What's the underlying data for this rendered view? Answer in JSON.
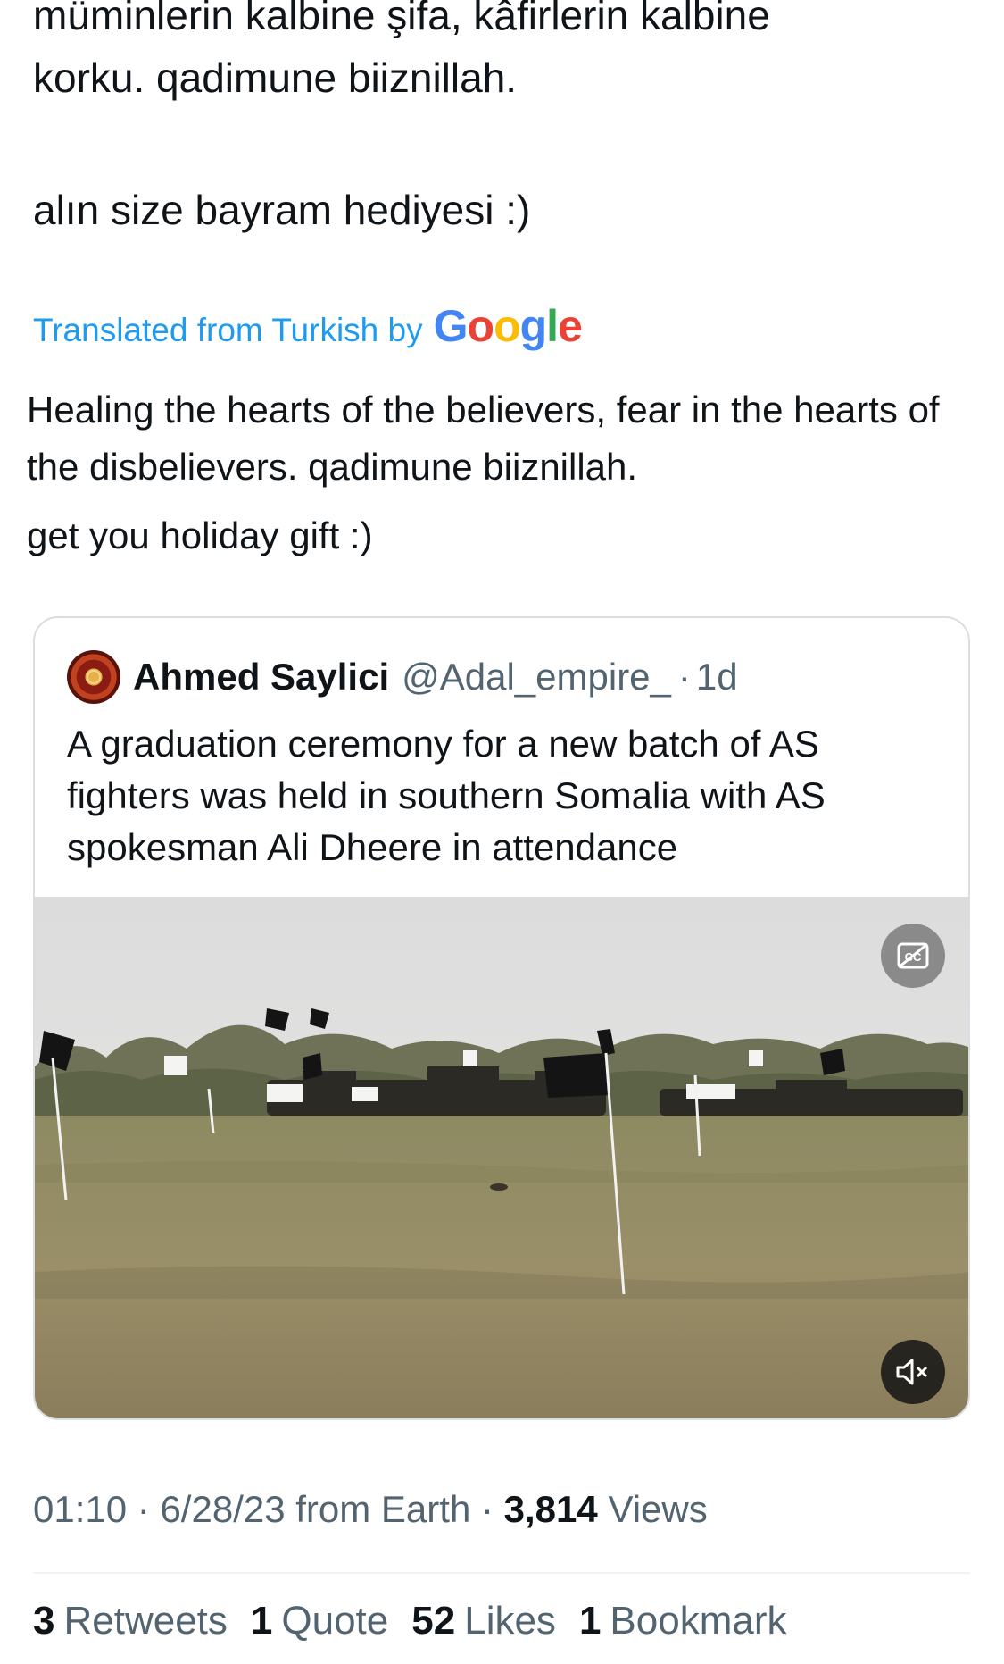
{
  "tweet": {
    "original_text_line_1": "müminlerin kalbine şifa, kâfirlerin kalbine\nkorku. qadimune biiznillah.",
    "original_text_line_2": "alın size bayram hediyesi :)",
    "translated_from": "Translated from Turkish by",
    "google_logo": "Google",
    "translation_line_1": "Healing the hearts of the believers, fear in the hearts of the disbelievers. qadimune biiznillah.",
    "translation_line_2": "get you holiday gift :)"
  },
  "quoted_tweet": {
    "author_name": "Ahmed Saylici",
    "author_handle": "@Adal_empire_",
    "separator": "·",
    "time_ago": "1d",
    "text": "A graduation ceremony for a new batch of AS fighters was held in southern Somalia with AS spokesman Ali Dheere in attendance",
    "avatar_icon": "emblem-avatar-icon",
    "media_icons": {
      "captions": "closed-captions-icon",
      "mute": "speaker-muted-icon"
    }
  },
  "meta": {
    "time": "01:10",
    "separator": "·",
    "date_source": "6/28/23 from Earth",
    "views_count": "3,814",
    "views_label": "Views"
  },
  "stats": [
    {
      "count": "3",
      "label": "Retweets"
    },
    {
      "count": "1",
      "label": "Quote"
    },
    {
      "count": "52",
      "label": "Likes"
    },
    {
      "count": "1",
      "label": "Bookmark"
    }
  ],
  "colors": {
    "text": "#0f1419",
    "secondary": "#536471",
    "link": "#1d9bf0",
    "border": "#d9dee2"
  }
}
